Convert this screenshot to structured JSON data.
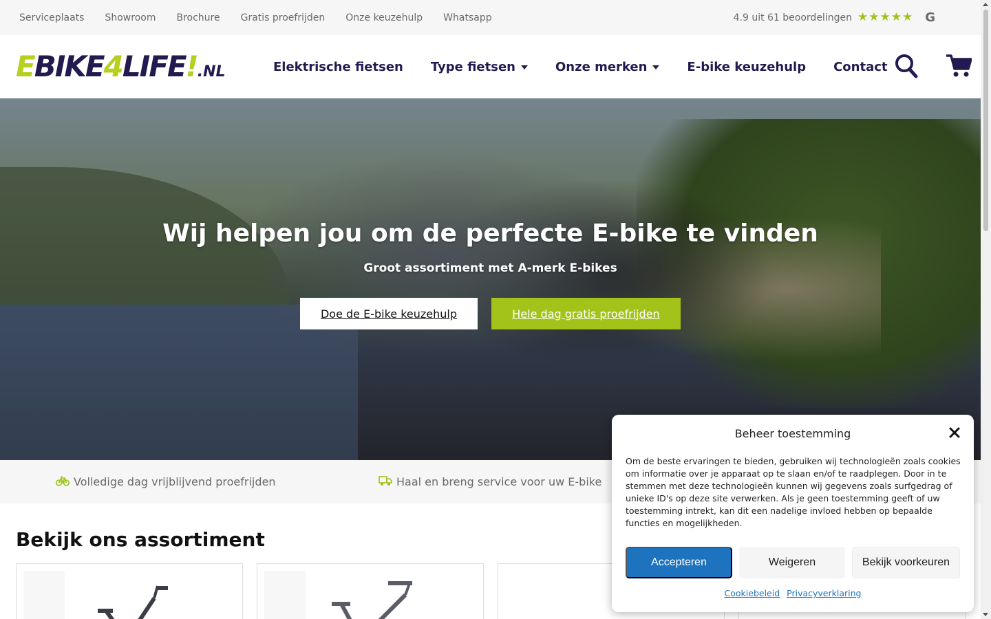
{
  "topbar": {
    "links": [
      "Serviceplaats",
      "Showroom",
      "Brochure",
      "Gratis proefrijden",
      "Onze keuzehulp",
      "Whatsapp"
    ],
    "rating_text": "4.9 uit 61 beoordelingen",
    "stars": 5,
    "star_color": "#9ec21b"
  },
  "header": {
    "logo": {
      "part1": "E",
      "part2": "BIKE",
      "part3": "4",
      "part4": "LIFE",
      "part5": "!",
      "part6": ".NL"
    },
    "nav": [
      "Elektrische fietsen",
      "Type fietsen",
      "Onze merken",
      "E-bike keuzehulp",
      "Contact"
    ],
    "icons": [
      "search-icon",
      "cart-icon"
    ]
  },
  "hero": {
    "title": "Wij helpen jou om de perfecte E-bike te vinden",
    "subtitle": "Groot assortiment met A-merk E-bikes",
    "btn_primary": "Doe de E-bike keuzehulp",
    "btn_secondary": "Hele dag gratis proefrijden"
  },
  "usp": [
    {
      "icon": "bicycle-icon",
      "text": "Volledige dag vrijblijvend proefrijden"
    },
    {
      "icon": "truck-icon",
      "text": "Haal en breng service voor uw E-bike"
    }
  ],
  "assortment": {
    "title": "Bekijk ons assortiment"
  },
  "consent": {
    "title": "Beheer toestemming",
    "text": "Om de beste ervaringen te bieden, gebruiken wij technologieën zoals cookies om informatie over je apparaat op te slaan en/of te raadplegen. Door in te stemmen met deze technologieën kunnen wij gegevens zoals surfgedrag of unieke ID's op deze site verwerken. Als je geen toestemming geeft of uw toestemming intrekt, kan dit een nadelige invloed hebben op bepaalde functies en mogelijkheden.",
    "accept": "Accepteren",
    "deny": "Weigeren",
    "prefs": "Bekijk voorkeuren",
    "link_cookie": "Cookiebeleid",
    "link_privacy": "Privacyverklaring"
  },
  "colors": {
    "brand_navy": "#221b4f",
    "brand_green": "#a4c31a",
    "accept_blue": "#1e73be"
  }
}
